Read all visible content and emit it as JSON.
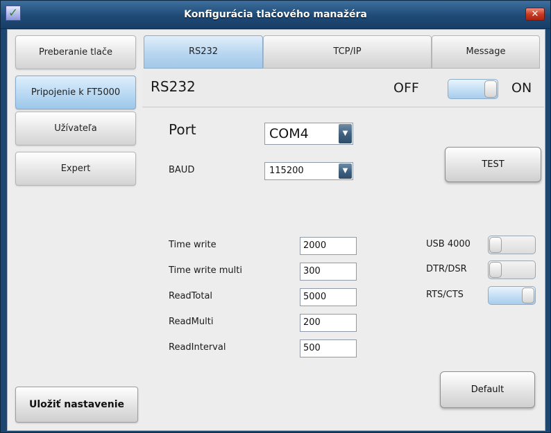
{
  "window": {
    "title": "Konfigurácia tlačového manažéra",
    "icon_name": "checkmark-icon",
    "close_label": "✕"
  },
  "sidebar": {
    "items": [
      {
        "label": "Preberanie tlače",
        "active": false
      },
      {
        "label": "Pripojenie k FT5000",
        "active": true
      },
      {
        "label": "Užívateľa",
        "active": false
      },
      {
        "label": "Expert",
        "active": false
      }
    ],
    "save_label": "Uložiť nastavenie"
  },
  "tabs": [
    {
      "label": "RS232",
      "active": true
    },
    {
      "label": "TCP/IP",
      "active": false
    },
    {
      "label": "Message",
      "active": false
    }
  ],
  "panel": {
    "title": "RS232",
    "off_label": "OFF",
    "on_label": "ON",
    "enabled": true,
    "port_label": "Port",
    "port_value": "COM4",
    "baud_label": "BAUD",
    "baud_value": "115200",
    "test_label": "TEST",
    "fields": [
      {
        "label": "Time write",
        "value": "2000"
      },
      {
        "label": "Time write multi",
        "value": "300"
      },
      {
        "label": "ReadTotal",
        "value": "5000"
      },
      {
        "label": "ReadMulti",
        "value": "200"
      },
      {
        "label": "ReadInterval",
        "value": "500"
      }
    ],
    "switches": [
      {
        "label": "USB 4000",
        "on": false
      },
      {
        "label": "DTR/DSR",
        "on": false
      },
      {
        "label": "RTS/CTS",
        "on": true
      }
    ],
    "default_label": "Default"
  },
  "colors": {
    "title_bar": "#1f4a76",
    "active_blue": "#b8d6f0",
    "close_red": "#c93a23",
    "dropdown_arrow": "#3e5f7d"
  }
}
